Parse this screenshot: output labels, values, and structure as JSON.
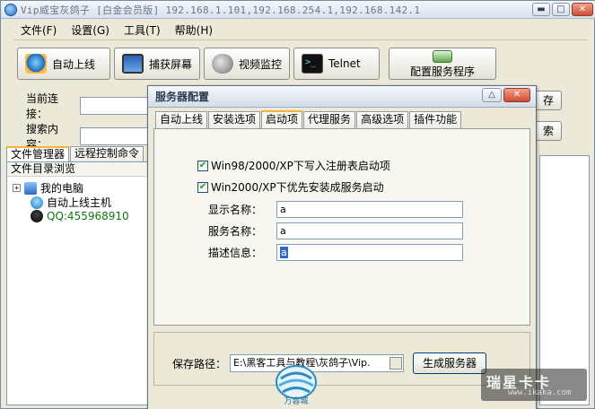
{
  "window": {
    "title": "Vip威宝灰鸽子 [白金会员版]  192.168.1.101,192.168.254.1,192.168.142.1",
    "buttons": {
      "minimize": "▬",
      "maximize": "□",
      "close": "✕"
    }
  },
  "menu": [
    "文件(F)",
    "设置(G)",
    "工具(T)",
    "帮助(H)"
  ],
  "toolbar": {
    "auto_online": "自动上线",
    "capture_screen": "捕获屏幕",
    "video_monitor": "视频监控",
    "telnet": "Telnet",
    "config_server": "配置服务程序"
  },
  "main": {
    "current_connection_label": "当前连接：",
    "search_label": "搜索内容：",
    "side_btn_1": "存",
    "side_btn_2": "索"
  },
  "left_tabs": [
    "文件管理器",
    "远程控制命令"
  ],
  "tree": {
    "header": "文件目录浏览",
    "nodes": [
      "我的电脑",
      "自动上线主机",
      "QQ:455968910"
    ]
  },
  "dialog": {
    "title": "服务器配置",
    "buttons": {
      "minimize": "△",
      "close": "✕"
    },
    "tabs": [
      "自动上线",
      "安装选项",
      "启动项",
      "代理服务",
      "高级选项",
      "插件功能"
    ],
    "checkbox_1": "Win98/2000/XP下写入注册表启动项",
    "checkbox_2": "Win2000/XP下优先安装成服务启动",
    "display_name_label": "显示名称：",
    "display_name_value": "a",
    "service_name_label": "服务名称：",
    "service_name_value": "a",
    "description_label": "描述信息：",
    "description_value": "a",
    "save_path_label": "保存路径：",
    "save_path_value": "E:\\黑客工具与教程\\灰鸽子\\Vip.",
    "generate_button": "生成服务器"
  },
  "watermark": {
    "logo_text": "万容城",
    "site_name": "瑞星卡卡",
    "site_url": "www.ikaka.com"
  },
  "colors": {
    "checked": "#21a121",
    "active_tab_accent": "#f6b23b",
    "selection": "#316ac5",
    "qq_text": "#0b7a0b"
  }
}
